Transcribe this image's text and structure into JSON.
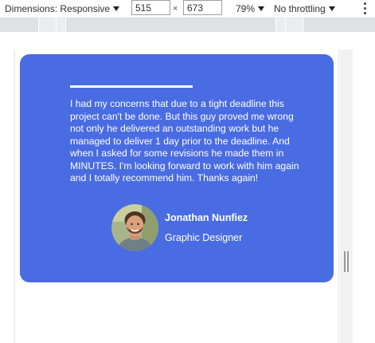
{
  "toolbar": {
    "dimensions_label": "Dimensions: Responsive",
    "width_value": "515",
    "times_symbol": "×",
    "height_value": "673",
    "zoom_label": "79%",
    "throttle_label": "No throttling",
    "menu_icon": "more-vert-icon"
  },
  "testimonial": {
    "quote": "I had my concerns that due to a tight deadline this project can't be done. But this guy proved me wrong not only he delivered an outstanding work but he managed to deliver 1 day prior to the deadline. And when I asked for some revisions he made them in MINUTES. I'm looking forward to work with him again and I totally recommend him. Thanks again!",
    "author_name": "Jonathan Nunfiez",
    "author_role": "Graphic Designer"
  },
  "colors": {
    "card_background": "#4a6ce2",
    "text": "#ffffff"
  }
}
